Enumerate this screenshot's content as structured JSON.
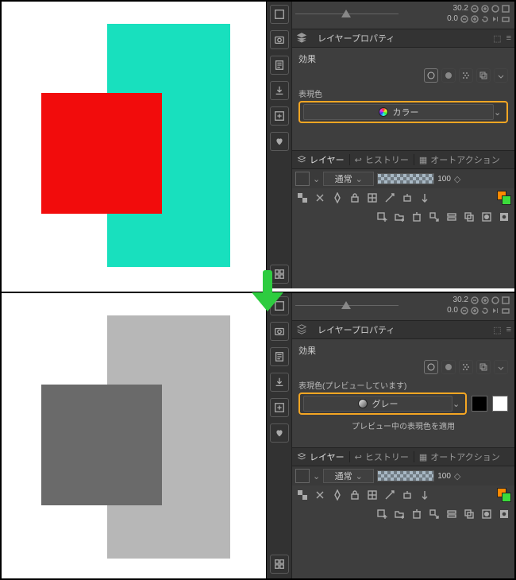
{
  "colors": {
    "top_rectA": "#18e0be",
    "top_rectB": "#f20c0c",
    "bot_rectA": "#b7b7b7",
    "bot_rectB": "#6a6a6a",
    "highlight": "#f5a623"
  },
  "status": {
    "angle": "30.2",
    "zoom": "0.0"
  },
  "tabs": {
    "layerprop": "レイヤープロパティ"
  },
  "effect_label": "効果",
  "top": {
    "field_label": "表現色",
    "dropdown": "カラー"
  },
  "bot": {
    "field_label": "表現色(プレビューしています)",
    "dropdown": "グレー",
    "hint": "プレビュー中の表現色を適用"
  },
  "ltabs": {
    "layer": "レイヤー",
    "history": "ヒストリー",
    "auto": "オートアクション"
  },
  "blend": {
    "mode": "通常",
    "opacity": "100"
  }
}
